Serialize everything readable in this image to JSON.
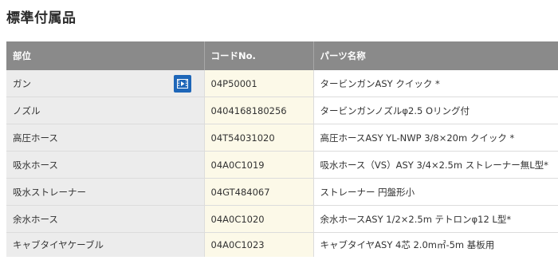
{
  "page": {
    "title": "標準付属品"
  },
  "table": {
    "headers": [
      "部位",
      "コードNo.",
      "パーツ名称"
    ],
    "rows": [
      {
        "part": "ガン",
        "code": "04P50001",
        "name": "タービンガンASY クイック *",
        "has_video": true
      },
      {
        "part": "ノズル",
        "code": "0404168180256",
        "name": "タービンガンノズルφ2.5 Oリング付",
        "has_video": false
      },
      {
        "part": "高圧ホース",
        "code": "04T54031020",
        "name": "高圧ホースASY YL-NWP 3/8×20m クイック *",
        "has_video": false
      },
      {
        "part": "吸水ホース",
        "code": "04A0C1019",
        "name": "吸水ホース（VS）ASY 3/4×2.5m ストレーナー無L型*",
        "has_video": false
      },
      {
        "part": "吸水ストレーナー",
        "code": "04GT484067",
        "name": "ストレーナー 円盤形小",
        "has_video": false
      },
      {
        "part": "余水ホース",
        "code": "04A0C1020",
        "name": "余水ホースASY 1/2×2.5m テトロンφ12 L型*",
        "has_video": false
      },
      {
        "part": "キャブタイヤケーブル",
        "code": "04A0C1023",
        "name": "キャブタイヤASY 4芯 2.0m㎡-5m 基板用",
        "has_video": false
      }
    ]
  },
  "icons": {
    "video": "video-play-icon"
  },
  "colors": {
    "header_bg": "#8a8a8a",
    "video_button": "#1e66b8",
    "code_column_bg": "#fcf9e8"
  }
}
